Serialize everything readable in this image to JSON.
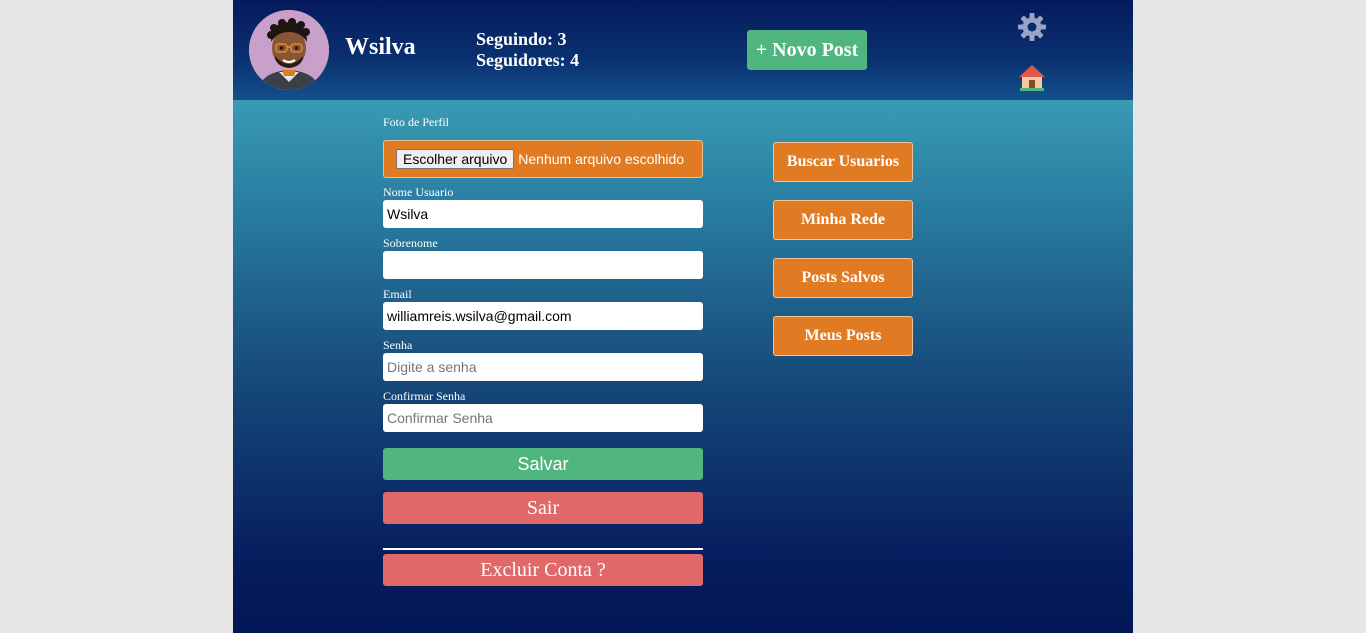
{
  "header": {
    "username": "Wsilva",
    "following": "Seguindo: 3",
    "followers": "Seguidores: 4",
    "new_post_label": "+ Novo Post",
    "settings_icon": "gear-icon",
    "home_icon": "home-icon"
  },
  "form": {
    "photo_label": "Foto de Perfil",
    "file_button": "Escolher arquivo",
    "file_status": "Nenhum arquivo escolhido",
    "name_label": "Nome Usuario",
    "name_value": "Wsilva",
    "surname_label": "Sobrenome",
    "surname_value": "",
    "email_label": "Email",
    "email_value": "williamreis.wsilva@gmail.com",
    "password_label": "Senha",
    "password_placeholder": "Digite a senha",
    "confirm_label": "Confirmar Senha",
    "confirm_placeholder": "Confirmar Senha",
    "save_label": "Salvar",
    "logout_label": "Sair",
    "delete_label": "Excluir Conta ?"
  },
  "sidebar": {
    "items": [
      {
        "label": "Buscar Usuarios"
      },
      {
        "label": "Minha Rede"
      },
      {
        "label": "Posts Salvos"
      },
      {
        "label": "Meus Posts"
      }
    ]
  },
  "colors": {
    "accent_orange": "#e07b24",
    "accent_green": "#51b57f",
    "accent_red": "#e06868",
    "header_navy": "#051a5c"
  }
}
